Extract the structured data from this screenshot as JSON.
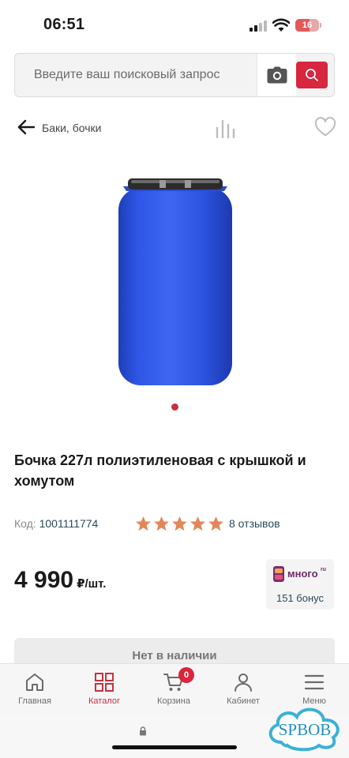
{
  "status_bar": {
    "time": "06:51",
    "battery": "16"
  },
  "search": {
    "placeholder": "Введите ваш поисковый запрос",
    "camera_icon": "camera-icon",
    "search_icon": "search-icon"
  },
  "nav": {
    "breadcrumb": "Баки, бочки",
    "back_icon": "arrow-left-icon",
    "compare_icon": "compare-icon",
    "favorite_icon": "heart-icon"
  },
  "product": {
    "title": "Бочка 227л полиэтиленовая с крышкой и хомутом",
    "code_label": "Код:",
    "code_value": "1001111774",
    "rating": 5,
    "rating_max": 5,
    "reviews": "8 отзывов",
    "price": "4 990",
    "price_unit": "₽/шт.",
    "image_count": 1,
    "image_active": 1
  },
  "bonus": {
    "brand": "много",
    "brand_suffix": "ru",
    "text": "151 бонус"
  },
  "stock_button": "Нет в наличии",
  "tab_bar": {
    "tabs": [
      {
        "label": "Главная",
        "icon": "home-icon",
        "active": false
      },
      {
        "label": "Каталог",
        "icon": "catalog-icon",
        "active": true
      },
      {
        "label": "Корзина",
        "icon": "cart-icon",
        "active": false,
        "badge": "0"
      },
      {
        "label": "Кабинет",
        "icon": "user-icon",
        "active": false
      },
      {
        "label": "Меню",
        "icon": "menu-icon",
        "active": false
      }
    ]
  },
  "watermark": "SPBOB",
  "colors": {
    "accent": "#d7263d",
    "star": "#e2875a",
    "link": "#2a4a5a",
    "barrel": "#2f57e8"
  }
}
